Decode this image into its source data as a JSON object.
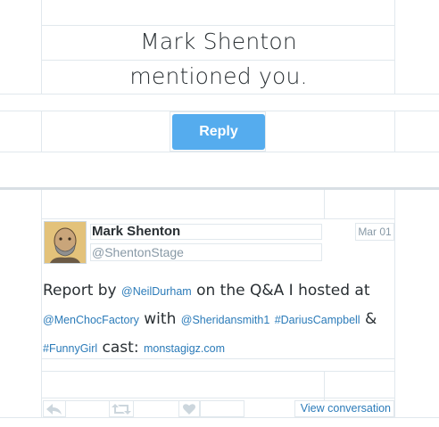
{
  "mention_card": {
    "line1": "Mark Shenton",
    "line2": "mentioned you.",
    "reply_label": "Reply"
  },
  "tweet": {
    "author_name": "Mark Shenton",
    "author_handle": "@ShentonStage",
    "date": "Mar 01",
    "text": {
      "t1": "Report by ",
      "l1": "@NeilDurham",
      "t2": " on the Q&A I hosted at",
      "l2": "@MenChocFactory",
      "t3": " with ",
      "l3": "@Sheridansmith1",
      "t4": " ",
      "l4": "#DariusCampbell",
      "t5": " &",
      "l5": "#FunnyGirl",
      "t6": " cast: ",
      "l6": "monstagigz.com"
    },
    "view_conversation_label": "View conversation"
  },
  "icons": [
    "reply-icon",
    "retweet-icon",
    "favorite-icon"
  ],
  "colors": {
    "accent": "#55acee",
    "link": "#2b7bb9",
    "muted": "#8899a6",
    "border": "#e1e8ed"
  }
}
